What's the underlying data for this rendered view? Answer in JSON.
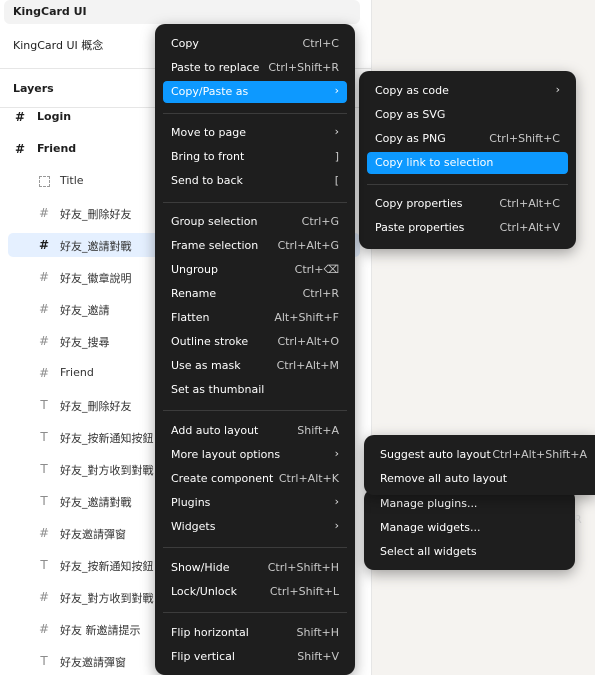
{
  "file": {
    "title": "KingCard UI",
    "page": "KingCard UI 概念"
  },
  "layers": {
    "title": "Layers",
    "items": [
      {
        "label": "Login",
        "icon": "frame-hash-icon"
      },
      {
        "label": "Friend",
        "icon": "frame-hash-icon"
      },
      {
        "label": "Title",
        "icon": "frame-dashed-icon"
      },
      {
        "label": "好友_刪除好友",
        "icon": "frame-hash-icon"
      },
      {
        "label": "好友_邀請對戰",
        "icon": "frame-hash-icon",
        "selected": true
      },
      {
        "label": "好友_徽章說明",
        "icon": "frame-hash-icon"
      },
      {
        "label": "好友_邀請",
        "icon": "frame-hash-icon"
      },
      {
        "label": "好友_搜尋",
        "icon": "frame-hash-icon"
      },
      {
        "label": "Friend",
        "icon": "frame-hash-icon"
      },
      {
        "label": "好友_刪除好友",
        "icon": "text-icon"
      },
      {
        "label": "好友_按新通知按鈕",
        "icon": "text-icon"
      },
      {
        "label": "好友_對方收到對戰",
        "icon": "text-icon"
      },
      {
        "label": "好友_邀請對戰",
        "icon": "text-icon"
      },
      {
        "label": "好友邀請彈窗",
        "icon": "frame-hash-icon"
      },
      {
        "label": "好友_按新通知按鈕",
        "icon": "text-icon"
      },
      {
        "label": "好友_對方收到對戰",
        "icon": "frame-hash-icon"
      },
      {
        "label": "好友 新邀請提示",
        "icon": "frame-hash-icon"
      },
      {
        "label": "好友邀請彈窗",
        "icon": "text-icon"
      }
    ]
  },
  "context_menu": {
    "items": [
      {
        "label": "Copy",
        "shortcut": "Ctrl+C"
      },
      {
        "label": "Paste to replace",
        "shortcut": "Ctrl+Shift+R"
      },
      {
        "label": "Copy/Paste as",
        "submenu": true,
        "highlight": true
      },
      {
        "label": "Move to page",
        "submenu": true
      },
      {
        "label": "Bring to front",
        "shortcut": "]"
      },
      {
        "label": "Send to back",
        "shortcut": "["
      },
      {
        "label": "Group selection",
        "shortcut": "Ctrl+G"
      },
      {
        "label": "Frame selection",
        "shortcut": "Ctrl+Alt+G"
      },
      {
        "label": "Ungroup",
        "shortcut": "Ctrl+⌫"
      },
      {
        "label": "Rename",
        "shortcut": "Ctrl+R"
      },
      {
        "label": "Flatten",
        "shortcut": "Alt+Shift+F"
      },
      {
        "label": "Outline stroke",
        "shortcut": "Ctrl+Alt+O"
      },
      {
        "label": "Use as mask",
        "shortcut": "Ctrl+Alt+M"
      },
      {
        "label": "Set as thumbnail",
        "shortcut": ""
      },
      {
        "label": "Add auto layout",
        "shortcut": "Shift+A"
      },
      {
        "label": "More layout options",
        "submenu": true
      },
      {
        "label": "Create component",
        "shortcut": "Ctrl+Alt+K"
      },
      {
        "label": "Plugins",
        "submenu": true
      },
      {
        "label": "Widgets",
        "submenu": true
      },
      {
        "label": "Show/Hide",
        "shortcut": "Ctrl+Shift+H"
      },
      {
        "label": "Lock/Unlock",
        "shortcut": "Ctrl+Shift+L"
      },
      {
        "label": "Flip horizontal",
        "shortcut": "Shift+H"
      },
      {
        "label": "Flip vertical",
        "shortcut": "Shift+V"
      }
    ]
  },
  "copy_paste_submenu": {
    "items": [
      {
        "label": "Copy as code",
        "submenu": true
      },
      {
        "label": "Copy as SVG",
        "shortcut": ""
      },
      {
        "label": "Copy as PNG",
        "shortcut": "Ctrl+Shift+C"
      },
      {
        "label": "Copy link to selection",
        "highlight": true
      },
      {
        "label": "Copy properties",
        "shortcut": "Ctrl+Alt+C"
      },
      {
        "label": "Paste properties",
        "shortcut": "Ctrl+Alt+V"
      }
    ]
  },
  "layout_submenu": {
    "items": [
      {
        "label": "Suggest auto layout",
        "shortcut": "Ctrl+Alt+Shift+A"
      },
      {
        "label": "Remove all auto layout"
      }
    ]
  },
  "plugins_submenu": {
    "items": [
      {
        "label": "Manage plugins..."
      }
    ]
  },
  "widgets_submenu": {
    "items": [
      {
        "label": "Manage widgets..."
      },
      {
        "label": "Select all widgets"
      }
    ],
    "partial_shortcut": "R"
  },
  "colors": {
    "menu_bg": "#1e1e1e",
    "accent": "#0d99ff",
    "selected_row": "#e5f0ff"
  }
}
